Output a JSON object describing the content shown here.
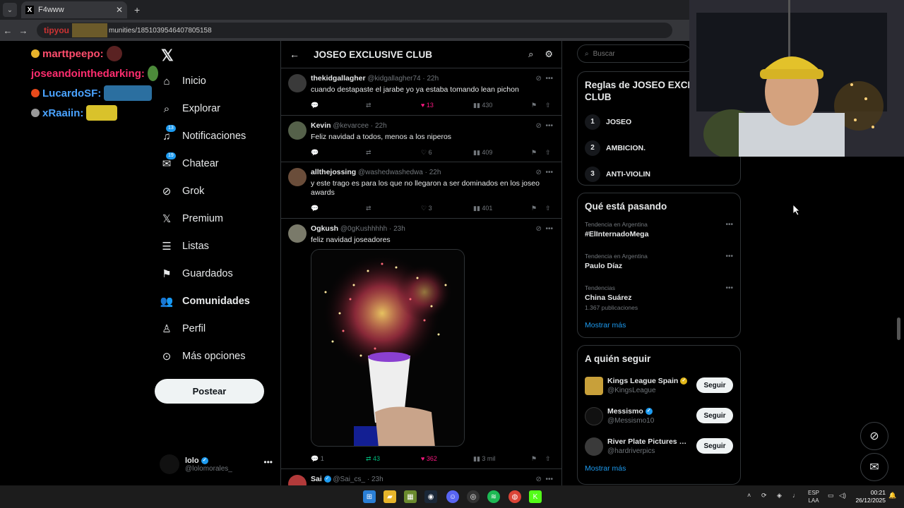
{
  "browser": {
    "tab_title": "F4www",
    "address": "munities/1851039546407805158",
    "omnibox_prefix": "tipyou"
  },
  "chat_overlay": [
    {
      "user": "marttpeepo:",
      "color": "#ff4d6d"
    },
    {
      "user": "joseandointhedarking:",
      "color": "#ff2d6f"
    },
    {
      "user": "LucardoSF:",
      "color": "#4aa3ff"
    },
    {
      "user": "xRaaiin:",
      "color": "#4aa3ff"
    }
  ],
  "nav": {
    "items": [
      {
        "label": "Inicio",
        "icon": "home-icon"
      },
      {
        "label": "Explorar",
        "icon": "search-icon"
      },
      {
        "label": "Notificaciones",
        "icon": "bell-icon",
        "badge": "13"
      },
      {
        "label": "Chatear",
        "icon": "mail-icon",
        "badge": "19"
      },
      {
        "label": "Grok",
        "icon": "grok-icon"
      },
      {
        "label": "Premium",
        "icon": "x-icon"
      },
      {
        "label": "Listas",
        "icon": "list-icon"
      },
      {
        "label": "Guardados",
        "icon": "bookmark-icon"
      },
      {
        "label": "Comunidades",
        "icon": "people-icon"
      },
      {
        "label": "Perfil",
        "icon": "person-icon"
      },
      {
        "label": "Más opciones",
        "icon": "more-icon"
      }
    ],
    "post_label": "Postear",
    "me": {
      "name": "lolo",
      "handle": "@lolomorales_"
    }
  },
  "timeline": {
    "title": "JOSEO EXCLUSIVE CLUB",
    "tweets": [
      {
        "name": "thekidgallagher",
        "handle": "@kidgallagher74",
        "time": "· 22h",
        "text": "cuando destapaste el jarabe yo ya estaba tomando lean pichon",
        "replies": "",
        "retweets": "",
        "likes": "13",
        "views": "430",
        "liked": true
      },
      {
        "name": "Kevin",
        "handle": "@kevarcee",
        "time": "· 22h",
        "text": "Feliz navidad a todos, menos a los niperos",
        "replies": "",
        "retweets": "",
        "likes": "6",
        "views": "409",
        "liked": false
      },
      {
        "name": "allthejossing",
        "handle": "@washedwashedwa",
        "time": "· 22h",
        "text": "y este trago es para los que no llegaron a ser dominados en los joseo awards",
        "replies": "",
        "retweets": "",
        "likes": "3",
        "views": "401",
        "liked": false
      },
      {
        "name": "Ogkush",
        "handle": "@0gKushhhhh",
        "time": "· 23h",
        "text": "feliz navidad joseadores",
        "replies": "1",
        "retweets": "43",
        "likes": "362",
        "views": "3 mil",
        "liked": true
      },
      {
        "name": "Sai",
        "handle": "@Sai_cs_",
        "time": "· 23h",
        "text": "",
        "replies": "",
        "retweets": "",
        "likes": "",
        "views": "",
        "liked": false
      }
    ]
  },
  "sidebar": {
    "search_placeholder": "Buscar",
    "rules": {
      "title": "Reglas de JOSEO EXCLUSIVE CLUB",
      "items": [
        {
          "n": "1",
          "label": "JOSEO"
        },
        {
          "n": "2",
          "label": "AMBICION."
        },
        {
          "n": "3",
          "label": "ANTI-VIOLIN"
        }
      ]
    },
    "trends": {
      "title": "Qué está pasando",
      "items": [
        {
          "category": "Tendencia en Argentina",
          "name": "#ElInternadoMega",
          "count": ""
        },
        {
          "category": "Tendencia en Argentina",
          "name": "Paulo Díaz",
          "count": ""
        },
        {
          "category": "Tendencias",
          "name": "China Suárez",
          "count": "1.367 publicaciones"
        }
      ],
      "more": "Mostrar más"
    },
    "follow": {
      "title": "A quién seguir",
      "items": [
        {
          "name": "Kings League Spain",
          "handle": "@KingsLeague",
          "button": "Seguir",
          "color": "#c8a03a"
        },
        {
          "name": "Messismo",
          "handle": "@Messismo10",
          "button": "Seguir",
          "color": "#111111"
        },
        {
          "name": "River Plate Pictures Th...",
          "handle": "@hardriverpics",
          "button": "Seguir",
          "color": "#3a3a3a"
        }
      ],
      "more": "Mostrar más"
    }
  },
  "taskbar": {
    "lang": "ESP",
    "lang2": "LAA",
    "time": "00:21",
    "date": "26/12/2025"
  }
}
